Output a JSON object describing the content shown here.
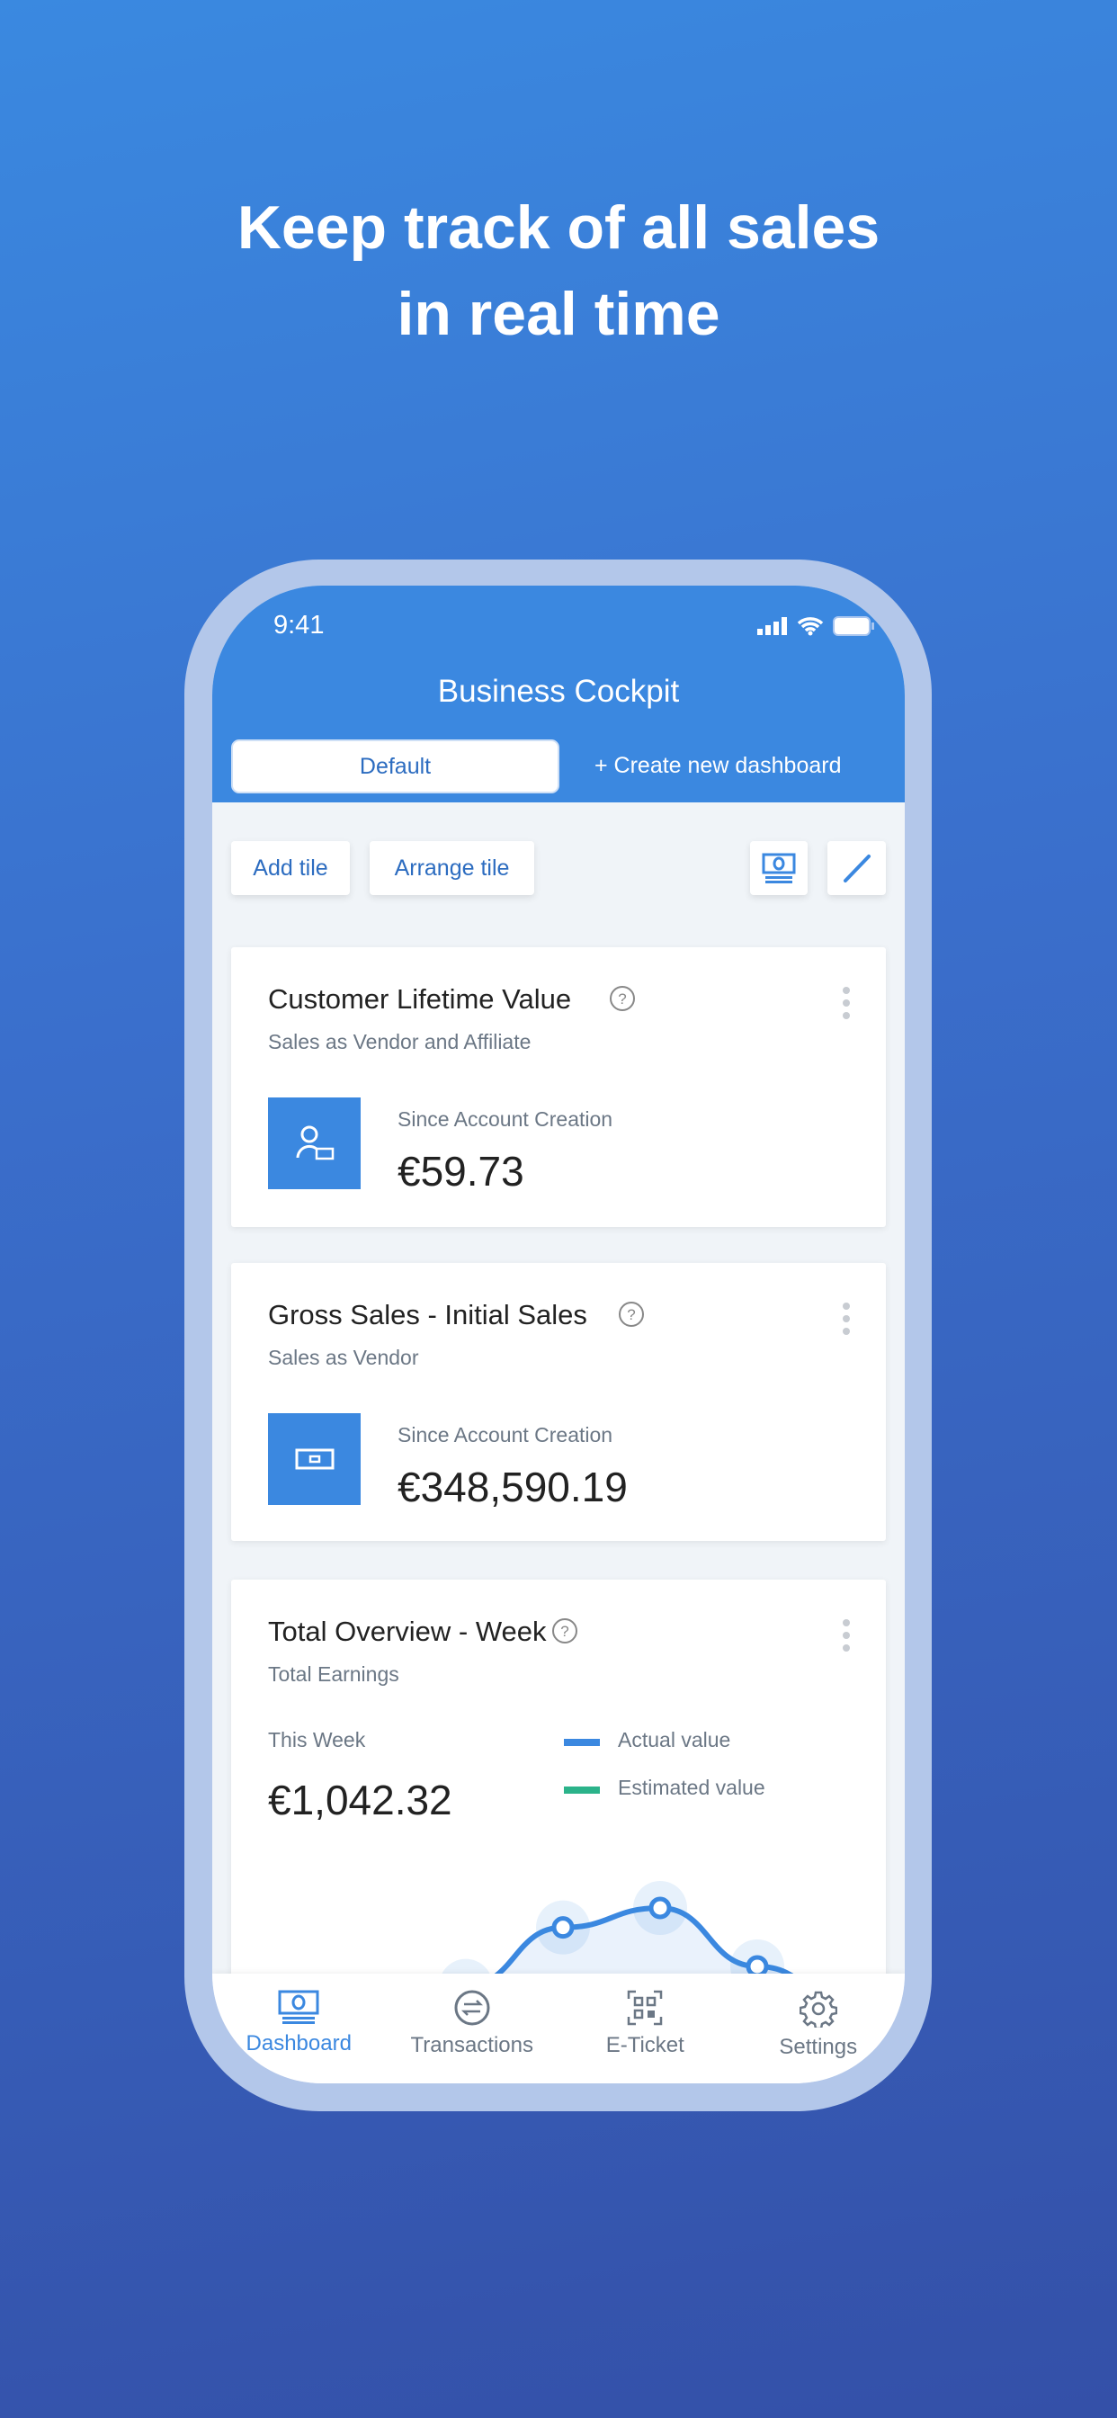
{
  "headline": {
    "line1": "Keep track of all sales",
    "line2": "in real time"
  },
  "status_bar": {
    "time": "9:41"
  },
  "header": {
    "title": "Business Cockpit",
    "tabs": [
      {
        "label": "Default",
        "active": true
      },
      {
        "label": "+ Create new dashboard"
      }
    ]
  },
  "toolbar": {
    "add_tile": "Add tile",
    "arrange_tile": "Arrange tile",
    "icons": [
      "money-icon",
      "pencil-icon"
    ]
  },
  "cards": [
    {
      "title": "Customer Lifetime Value",
      "subtitle": "Sales as Vendor and Affiliate",
      "label": "Since Account Creation",
      "value": "€59.73",
      "icon": "user-money-icon"
    },
    {
      "title": "Gross Sales - Initial Sales",
      "subtitle": "Sales as Vendor",
      "label": "Since Account Creation",
      "value": "€348,590.19",
      "icon": "cash-icon"
    },
    {
      "title": "Total Overview - Week",
      "subtitle": "Total Earnings",
      "label": "This Week",
      "value": "€1,042.32",
      "legend": [
        {
          "name": "Actual value",
          "color": "#3b88e0"
        },
        {
          "name": "Estimated value",
          "color": "#2bb38a"
        }
      ]
    }
  ],
  "chart_data": {
    "type": "line",
    "series": [
      {
        "name": "Actual value",
        "values": [
          1,
          1,
          2,
          5,
          6,
          3,
          1
        ]
      }
    ],
    "grid": false
  },
  "nav": {
    "items": [
      {
        "label": "Dashboard",
        "active": true
      },
      {
        "label": "Transactions"
      },
      {
        "label": "E-Ticket"
      },
      {
        "label": "Settings"
      }
    ]
  },
  "colors": {
    "accent": "#3b88e0",
    "estimated": "#2bb38a"
  }
}
